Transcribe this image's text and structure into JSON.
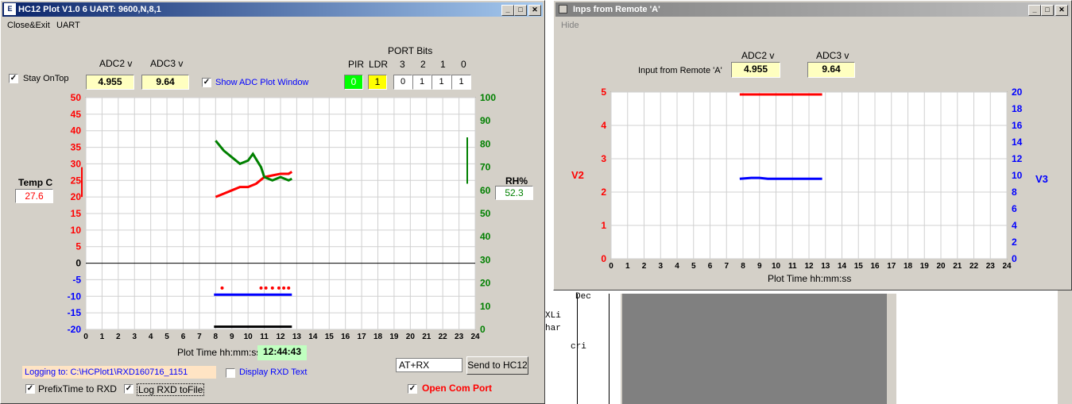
{
  "main_window": {
    "title": "HC12 Plot V1.0 6 UART: 9600,N,8,1",
    "menu": [
      "Close&Exit",
      "UART"
    ],
    "stay_on_top": "Stay OnTop",
    "adc2_label": "ADC2 v",
    "adc3_label": "ADC3 v",
    "adc2_value": "4.955",
    "adc3_value": "9.64",
    "show_adc_plot": "Show ADC Plot Window",
    "port_bits_title": "PORT Bits",
    "port_labels": [
      "PIR",
      "LDR",
      "3",
      "2",
      "1",
      "0"
    ],
    "port_values": [
      "0",
      "1",
      "0",
      "1",
      "1",
      "1"
    ],
    "temp_label": "Temp C",
    "temp_value": "27.6",
    "rh_label": "RH%",
    "rh_value": "52.3",
    "plot_time_label": "Plot  Time hh:mm:ss",
    "time_value": "12:44:43",
    "logging": "Logging to: C:\\HCPlot1\\RXD160716_1151",
    "display_rxd": "Display RXD Text",
    "cmd_value": "AT+RX",
    "send_button": "Send to HC12",
    "prefix_time": "PrefixTime to RXD",
    "log_rxd": "Log RXD toFile",
    "open_com": "Open Com Port"
  },
  "remote_window": {
    "title": "Inps from Remote 'A'",
    "menu": [
      "Hide"
    ],
    "adc2_label": "ADC2 v",
    "adc3_label": "ADC3 v",
    "input_label": "Input from Remote 'A'",
    "adc2_value": "4.955",
    "adc3_value": "9.64",
    "v2_label": "V2",
    "v3_label": "V3",
    "plot_time_label": "Plot  Time hh:mm:ss"
  },
  "background_text": [
    "Dec",
    "XLi",
    "har",
    "cri"
  ],
  "colors": {
    "temp": "#ff0000",
    "rh": "#008000",
    "adc": "#0000ff",
    "black": "#000000",
    "title_active": "#0a246a",
    "highlight_green": "#00ff00",
    "highlight_yellow": "#ffff00"
  },
  "chart_data": [
    {
      "type": "line",
      "x_ticks": [
        "0",
        "1",
        "2",
        "3",
        "4",
        "5",
        "6",
        "7",
        "8",
        "9",
        "10",
        "11",
        "12",
        "13",
        "14",
        "15",
        "16",
        "17",
        "18",
        "19",
        "20",
        "21",
        "22",
        "23",
        "24"
      ],
      "xlim": [
        0,
        24
      ],
      "y_left_ticks": [
        "50",
        "45",
        "40",
        "35",
        "30",
        "25",
        "20",
        "15",
        "10",
        "5",
        "0",
        "-5",
        "-10",
        "-15",
        "-20"
      ],
      "ylim_left": [
        -20,
        50
      ],
      "y_right_ticks": [
        "100",
        "90",
        "80",
        "70",
        "60",
        "50",
        "40",
        "30",
        "20",
        "10",
        "0"
      ],
      "ylim_right": [
        0,
        100
      ],
      "grid": true,
      "series": [
        {
          "axis": "left",
          "color": "#ff0000",
          "x": [
            8,
            8.5,
            9,
            9.5,
            10,
            10.5,
            11,
            11.5,
            12,
            12.5,
            12.7
          ],
          "y": [
            20,
            21,
            22,
            23,
            23,
            24,
            26,
            26.5,
            27,
            27,
            27.6
          ]
        },
        {
          "axis": "left",
          "color": "#008000",
          "x": [
            8,
            8.5,
            9,
            9.5,
            10,
            10.3,
            10.8,
            11,
            11.5,
            12,
            12.5,
            12.7
          ],
          "y": [
            37,
            34,
            32,
            30,
            31,
            33,
            29,
            26,
            25,
            26,
            25,
            25.5
          ]
        },
        {
          "axis": "left",
          "color": "#0000ff",
          "x": [
            7.9,
            12.7
          ],
          "y": [
            -9.5,
            -9.5
          ]
        },
        {
          "axis": "left",
          "color": "#000000",
          "x": [
            7.9,
            12.7
          ],
          "y": [
            -19.2,
            -19.2
          ]
        },
        {
          "axis": "left",
          "color": "#ff0000",
          "x": [
            8.4,
            10.8,
            11.1,
            11.5,
            11.9,
            12.2,
            12.5
          ],
          "y": [
            -7.5,
            -7.5,
            -7.5,
            -7.5,
            -7.5,
            -7.5,
            -7.5
          ],
          "style": "points"
        }
      ]
    },
    {
      "type": "line",
      "x_ticks": [
        "0",
        "1",
        "2",
        "3",
        "4",
        "5",
        "6",
        "7",
        "8",
        "9",
        "10",
        "11",
        "12",
        "13",
        "14",
        "15",
        "16",
        "17",
        "18",
        "19",
        "20",
        "21",
        "22",
        "23",
        "24"
      ],
      "xlim": [
        0,
        24
      ],
      "y_left_ticks": [
        "5",
        "4",
        "3",
        "2",
        "1",
        "0"
      ],
      "ylim_left": [
        0,
        5
      ],
      "y_right_ticks": [
        "20",
        "18",
        "16",
        "14",
        "12",
        "10",
        "8",
        "6",
        "4",
        "2",
        "0"
      ],
      "ylim_right": [
        0,
        20
      ],
      "ylabel_left": "V2",
      "ylabel_right": "V3",
      "xlabel": "Plot  Time hh:mm:ss",
      "grid": true,
      "series": [
        {
          "axis": "left",
          "color": "#ff0000",
          "x": [
            7.8,
            12.8
          ],
          "y": [
            4.93,
            4.93
          ]
        },
        {
          "axis": "right",
          "color": "#0000ff",
          "x": [
            7.8,
            8.5,
            9,
            9.5,
            12.8
          ],
          "y": [
            9.6,
            9.7,
            9.7,
            9.6,
            9.6
          ]
        }
      ]
    }
  ]
}
